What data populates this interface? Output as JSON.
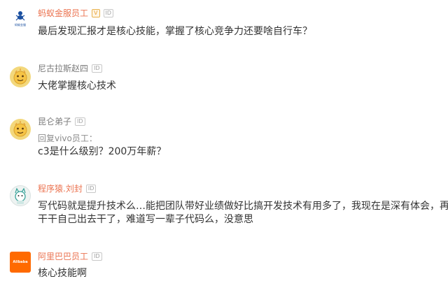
{
  "comments": [
    {
      "username": "蚂蚁金服员工",
      "badges": [
        "V",
        "ID"
      ],
      "avatar": {
        "icon": "ant-financial-logo",
        "text": "蚂蚁金服"
      },
      "text": "最后发现汇报才是核心技能，掌握了核心竞争力还要啥自行车？"
    },
    {
      "username": "尼古拉斯赵四",
      "badges": [
        "ID"
      ],
      "avatar": {
        "icon": "yellow-mascot-avatar"
      },
      "text": "大佬掌握核心技术"
    },
    {
      "username": "昆仑弟子",
      "badges": [
        "ID"
      ],
      "avatar": {
        "icon": "yellow-mascot-avatar"
      },
      "reply_to": "回复vivo员工：",
      "text": "c3是什么级别？200万年薪？"
    },
    {
      "username": "程序猿.刘封",
      "badges": [
        "ID"
      ],
      "avatar": {
        "icon": "cartoon-cat-avatar"
      },
      "text_lines": [
        "写代码就是提升技术么…能把团队带好业绩做好比搞开发技术有用多了，我现在是深有体会，再",
        "干干自己出去干了，难道写一辈子代码么，没意思"
      ]
    },
    {
      "username": "阿里巴巴员工",
      "badges": [
        "ID"
      ],
      "avatar": {
        "icon": "alibaba-logo",
        "text": "Alibaba"
      },
      "text": "核心技能啊"
    }
  ],
  "colors": {
    "username_orange": "#eb7350",
    "username_gray": "#7a7a7a",
    "body_text": "#333333",
    "reply_gray": "#8c8c8c",
    "alibaba_orange": "#ff6a00",
    "mascot_yellow": "#f3d87c"
  }
}
